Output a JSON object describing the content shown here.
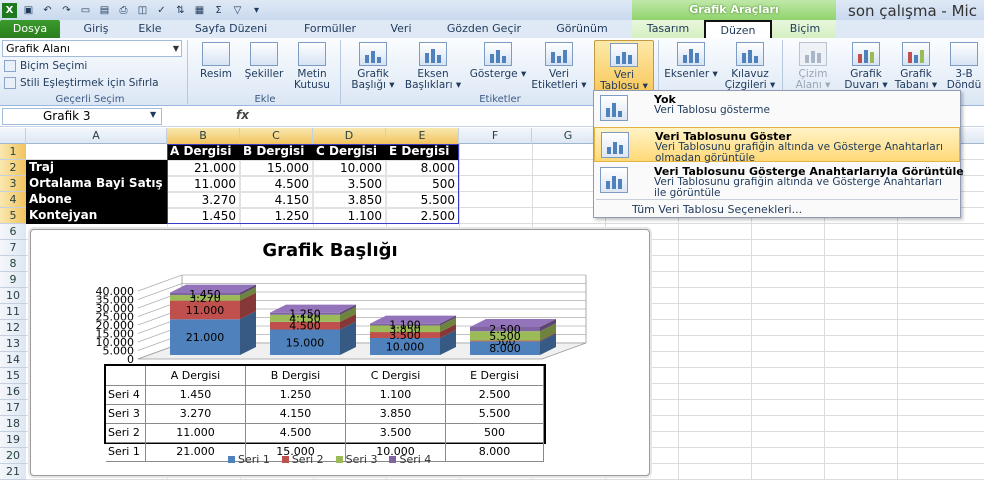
{
  "window": {
    "title": "son çalışma - Mic",
    "context_tools": "Grafik Araçları"
  },
  "tabs": [
    "Dosya",
    "Giriş",
    "Ekle",
    "Sayfa Düzeni",
    "Formüller",
    "Veri",
    "Gözden Geçir",
    "Görünüm",
    "Tasarım",
    "Düzen",
    "Biçim"
  ],
  "ribbon": {
    "current_selection": {
      "dropdown_value": "Grafik Alanı",
      "format_selection": "Biçim Seçimi",
      "reset_style": "Stili Eşleştirmek için Sıfırla",
      "group_label": "Geçerli Seçim"
    },
    "insert": {
      "picture": "Resim",
      "shapes": "Şekiller",
      "textbox_1": "Metin",
      "textbox_2": "Kutusu",
      "group_label": "Ekle"
    },
    "labels": {
      "chart_title_1": "Grafik",
      "chart_title_2": "Başlığı ▾",
      "axis_titles_1": "Eksen",
      "axis_titles_2": "Başlıkları ▾",
      "legend": "Gösterge ▾",
      "data_labels_1": "Veri",
      "data_labels_2": "Etiketleri ▾",
      "data_table_1": "Veri",
      "data_table_2": "Tablosu ▾",
      "group_label": "Etiketler"
    },
    "axes": {
      "axes": "Eksenler ▾",
      "gridlines_1": "Kılavuz",
      "gridlines_2": "Çizgileri ▾"
    },
    "background": {
      "plot_area_1": "Çizim",
      "plot_area_2": "Alanı ▾",
      "chart_wall_1": "Grafik",
      "chart_wall_2": "Duvarı ▾",
      "chart_floor_1": "Grafik",
      "chart_floor_2": "Tabanı ▾",
      "rotation_1": "3-B",
      "rotation_2": "Döndü"
    }
  },
  "formula_bar": {
    "name_box": "Grafik 3",
    "fx": "fx"
  },
  "columns": [
    "A",
    "B",
    "C",
    "D",
    "E",
    "F",
    "G"
  ],
  "rows": [
    "1",
    "2",
    "3",
    "4",
    "5",
    "6",
    "7",
    "8",
    "9",
    "10",
    "11",
    "12",
    "13",
    "14",
    "15",
    "16",
    "17",
    "18",
    "19",
    "20",
    "21"
  ],
  "sheet": {
    "headers": [
      "A Dergisi",
      "B Dergisi",
      "C Dergisi",
      "E Dergisi"
    ],
    "data": [
      {
        "label": "Traj",
        "values": [
          "21.000",
          "15.000",
          "10.000",
          "8.000"
        ]
      },
      {
        "label": "Ortalama Bayi Satış",
        "values": [
          "11.000",
          "4.500",
          "3.500",
          "500"
        ]
      },
      {
        "label": "Abone",
        "values": [
          "3.270",
          "4.150",
          "3.850",
          "5.500"
        ]
      },
      {
        "label": "Kontejyan",
        "values": [
          "1.450",
          "1.250",
          "1.100",
          "2.500"
        ]
      }
    ]
  },
  "chart_data": {
    "type": "bar",
    "title": "Grafik Başlığı",
    "categories": [
      "A Dergisi",
      "B Dergisi",
      "C Dergisi",
      "E Dergisi"
    ],
    "series": [
      {
        "name": "Seri 1",
        "values": [
          21000,
          15000,
          10000,
          8000
        ],
        "color": "#4f81bd",
        "labels": [
          "21.000",
          "15.000",
          "10.000",
          "8.000"
        ]
      },
      {
        "name": "Seri 2",
        "values": [
          11000,
          4500,
          3500,
          500
        ],
        "color": "#c0504d",
        "labels": [
          "11.000",
          "4.500",
          "3.500",
          "500"
        ]
      },
      {
        "name": "Seri 3",
        "values": [
          3270,
          4150,
          3850,
          5500
        ],
        "color": "#9bbb59",
        "labels": [
          "3.270",
          "4.150",
          "3.850",
          "5.500"
        ]
      },
      {
        "name": "Seri 4",
        "values": [
          1450,
          1250,
          1100,
          2500
        ],
        "color": "#8064a2",
        "labels": [
          "1.450",
          "1.250",
          "1.100",
          "2.500"
        ]
      }
    ],
    "stacked": true,
    "three_d": true,
    "ylim": [
      0,
      40000
    ],
    "yticks": [
      "0",
      "5.000",
      "10.000",
      "15.000",
      "20.000",
      "25.000",
      "30.000",
      "35.000",
      "40.000"
    ],
    "grid": true,
    "legend": "bottom",
    "data_table_rows": [
      "Seri 4",
      "Seri 3",
      "Seri 2",
      "Seri 1"
    ]
  },
  "menu": {
    "items": [
      {
        "title": "Yok",
        "desc": "Veri Tablosu gösterme"
      },
      {
        "title": "Veri Tablosunu Göster",
        "desc": "Veri Tablosunu grafiğin altında ve Gösterge Anahtarları olmadan görüntüle"
      },
      {
        "title": "Veri Tablosunu Gösterge Anahtarlarıyla Görüntüle",
        "desc": "Veri Tablosunu grafiğin altında ve Gösterge Anahtarları ile görüntüle"
      }
    ],
    "more": "Tüm Veri Tablosu Seçenekleri..."
  }
}
